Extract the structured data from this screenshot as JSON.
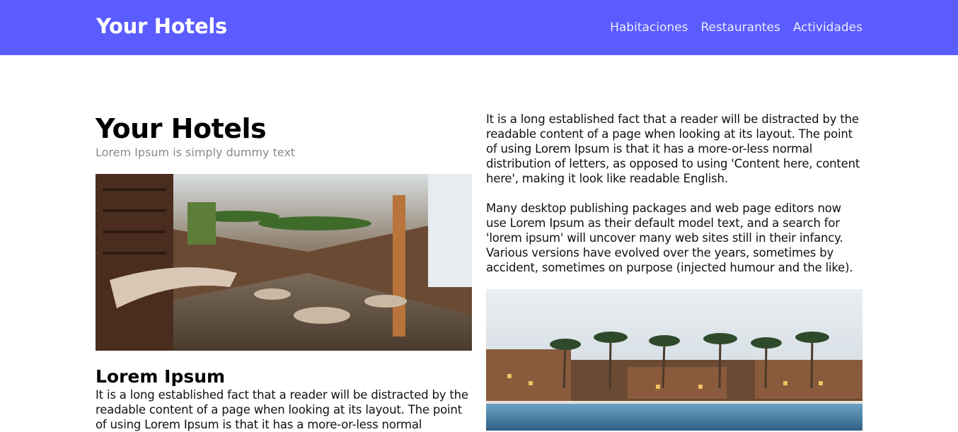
{
  "navbar": {
    "brand": "Your Hotels",
    "links": [
      "Habitaciones",
      "Restaurantes",
      "Actividades"
    ]
  },
  "hero": {
    "title": "Your Hotels",
    "subtitle": "Lorem Ipsum is simply dummy text"
  },
  "left_section": {
    "title": "Lorem Ipsum",
    "text": "It is a long established fact that a reader will be distracted by the readable content of a page when looking at its layout. The point of using Lorem Ipsum is that it has a more-or-less normal"
  },
  "right_column": {
    "paragraphs": [
      "It is a long established fact that a reader will be distracted by the readable content of a page when looking at its layout. The point of using Lorem Ipsum is that it has a more-or-less normal distribution of letters, as opposed to using 'Content here, content here', making it look like readable English.",
      "Many desktop publishing packages and web page editors now use Lorem Ipsum as their default model text, and a search for 'lorem ipsum' will uncover many web sites still in their infancy. Various versions have evolved over the years, sometimes by accident, sometimes on purpose (injected humour and the like)."
    ]
  },
  "colors": {
    "navbar_bg": "#5b5cff",
    "brand": "#ffffff",
    "subtitle": "#8a8a8a"
  }
}
